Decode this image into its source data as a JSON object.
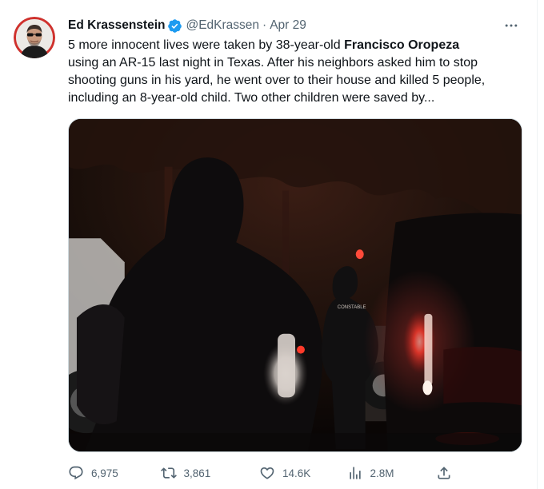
{
  "tweet": {
    "author_name": "Ed Krassenstein",
    "handle": "@EdKrassen",
    "separator": "·",
    "date": "Apr 29",
    "text": {
      "line1_pre": "5 more innocent lives were taken by 38-year-old ",
      "line1_bold": "Francisco Oropeza",
      "line2": "using an AR-15 last night in Texas.  After his neighbors asked him to stop",
      "line3": "shooting guns in his yard, he went over to their house and killed 5 people,",
      "line4": "including an 8-year-old child. Two other children were saved by..."
    },
    "media": {
      "vest_text": "CONSTABLE"
    },
    "metrics": {
      "replies": "6,975",
      "retweets": "3,861",
      "likes": "14.6K",
      "views": "2.8M"
    }
  },
  "colors": {
    "text_primary": "#0f1419",
    "text_secondary": "#536471",
    "verified_blue": "#1d9bf0",
    "avatar_ring": "#d0312d"
  },
  "icons": {
    "verified": "verified-badge-icon",
    "more": "more-horizontal-icon",
    "reply": "reply-icon",
    "retweet": "retweet-icon",
    "like": "heart-icon",
    "views": "views-chart-icon",
    "share": "share-icon"
  }
}
